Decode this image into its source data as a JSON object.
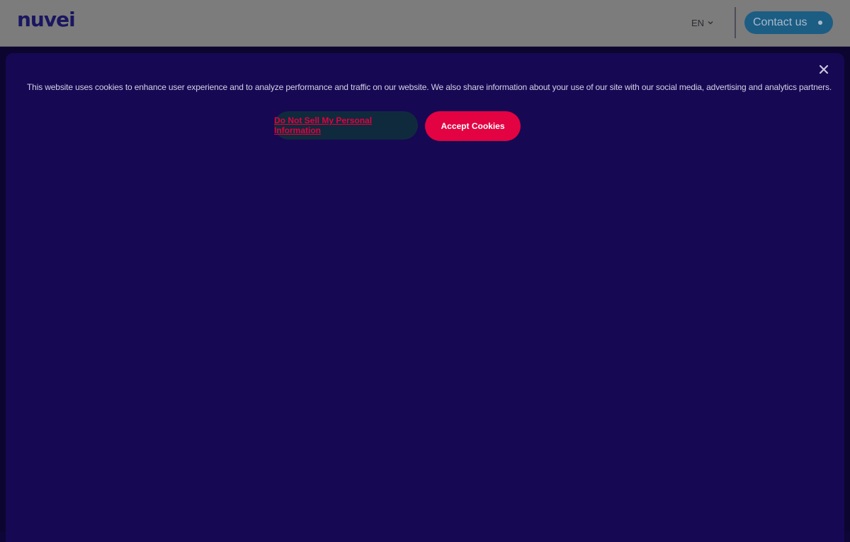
{
  "header": {
    "logo_text": "nuvei",
    "language": "EN",
    "language_icon": "chevron-down-icon",
    "contact_label": "Contact us"
  },
  "cookie_banner": {
    "close_icon": "close-icon",
    "notice": "This website uses cookies to enhance user experience and to analyze performance and traffic on our website. We also share information about your use of our site with our social media, advertising and analytics partners.",
    "do_not_sell_label": "Do Not Sell My Personal Information",
    "accept_label": "Accept Cookies"
  },
  "colors": {
    "panel": "#160853",
    "accent": "#e30242",
    "header_dimmed": "#7c7c7c"
  }
}
